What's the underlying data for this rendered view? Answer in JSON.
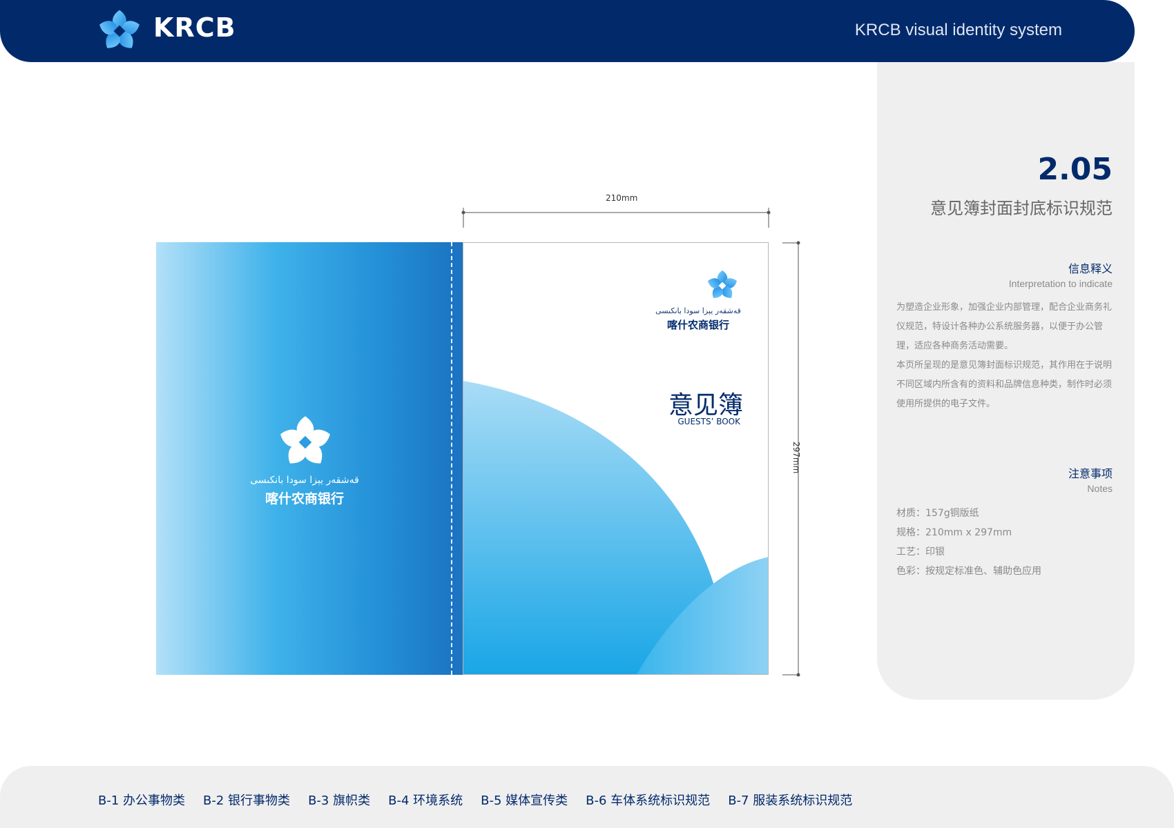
{
  "header": {
    "brand": "KRCB",
    "tagline": "KRCB visual identity system"
  },
  "panel": {
    "section_number": "2.05",
    "section_title": "意见簿封面封底标识规范",
    "info": {
      "title_cn": "信息释义",
      "title_en": "Interpretation to indicate",
      "paragraph_1": "为塑造企业形象，加强企业内部管理，配合企业商务礼仪规范，特设计各种办公系统服务器，以便于办公管理，适应各种商务活动需要。",
      "paragraph_2": "本页所呈现的是意见簿封面标识规范，其作用在于说明不同区域内所含有的资料和品牌信息种类，制作时必须使用所提供的电子文件。"
    },
    "notes": {
      "title_cn": "注意事项",
      "title_en": "Notes",
      "items": [
        "材质：157g铜版纸",
        "规格：210mm x 297mm",
        "工艺：印银",
        "色彩：按规定标准色、辅助色应用"
      ]
    }
  },
  "mockup": {
    "width_label": "210mm",
    "height_label": "297mm",
    "back_cover": {
      "uyghur_name": "قەشقەر يېزا سودا بانكىسى",
      "chinese_name": "喀什农商银行"
    },
    "front_cover": {
      "uyghur_name": "قەشقەر يېزا سودا بانكىسى",
      "chinese_name": "喀什农商银行",
      "title": "意见簿",
      "subtitle": "GUESTS’ BOOK"
    }
  },
  "footer": {
    "nav": [
      "B-1 办公事物类",
      "B-2 银行事物类",
      "B-3 旗帜类",
      "B-4 环境系统",
      "B-5 媒体宣传类",
      "B-6 车体系统标识规范",
      "B-7 服装系统标识规范"
    ]
  },
  "colors": {
    "brand_navy": "#022a6b",
    "panel_gray": "#efefef",
    "cover_blue": "#2490d8",
    "cover_light_blue": "#b3e0f8"
  }
}
